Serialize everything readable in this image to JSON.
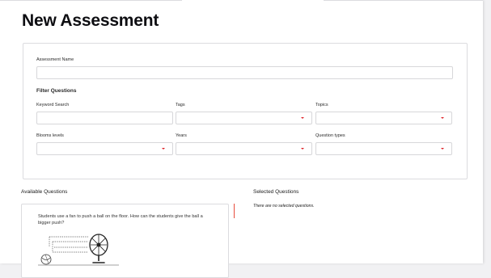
{
  "title": "New Assessment",
  "form": {
    "assessment_name_label": "Assessment Name",
    "filter_section_label": "Filter Questions",
    "keyword_label": "Keyword Search",
    "tags_label": "Tags",
    "topics_label": "Topics",
    "blooms_label": "Blooms levels",
    "years_label": "Years",
    "qtypes_label": "Question types"
  },
  "available": {
    "heading": "Available Questions",
    "question_text": "Students use a fan to push a ball on the floor. How can the students give the ball a bigger push?"
  },
  "selected": {
    "heading": "Selected Questions",
    "empty_message": "There are no selected questions."
  },
  "colors": {
    "accent_red": "#e0252b",
    "title": "#0e0e12",
    "border": "#dcdcdf"
  }
}
